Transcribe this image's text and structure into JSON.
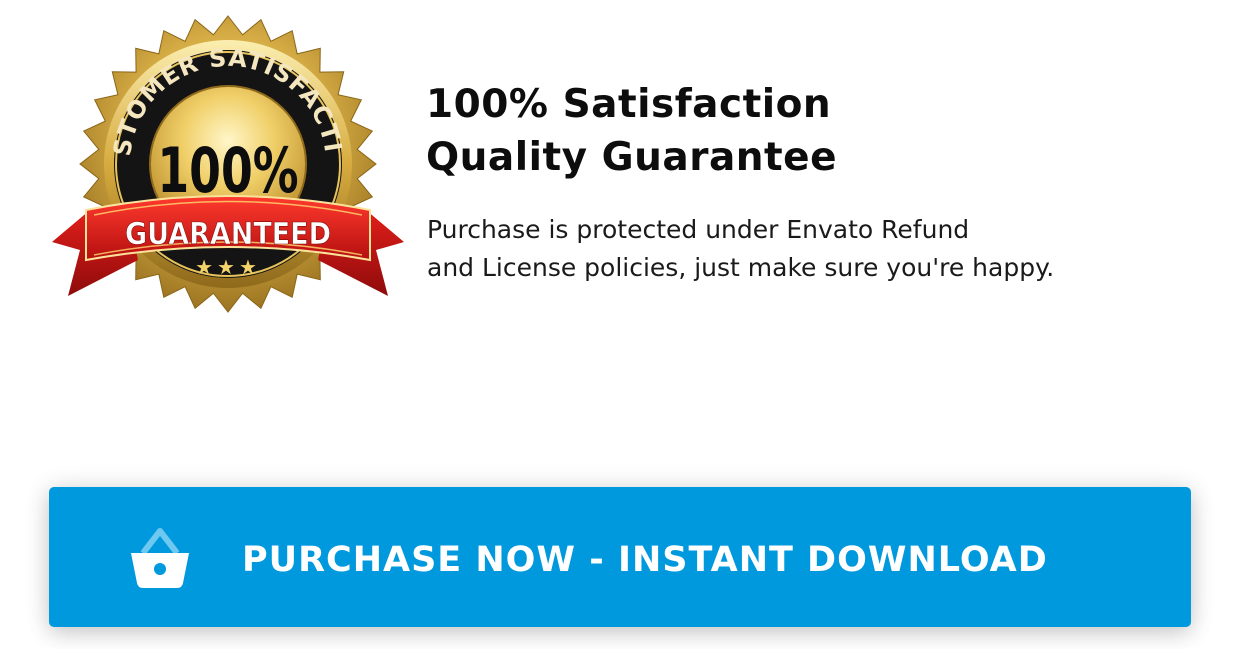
{
  "badge": {
    "top_text": "CUSTOMER SATISFACTION",
    "percent": "100%",
    "ribbon_text": "GUARANTEED",
    "stars": "★★★"
  },
  "headline": {
    "line1": "100% Satisfaction",
    "line2": "Quality Guarantee"
  },
  "description": {
    "line1": "Purchase is protected under Envato Refund",
    "line2": "and License policies, just make sure you're happy."
  },
  "purchase_button": {
    "label": "PURCHASE NOW - INSTANT DOWNLOAD",
    "icon": "basket-icon"
  },
  "colors": {
    "button": "#0099dd",
    "gold": "#c9a13c",
    "ribbon": "#d81a1a"
  }
}
